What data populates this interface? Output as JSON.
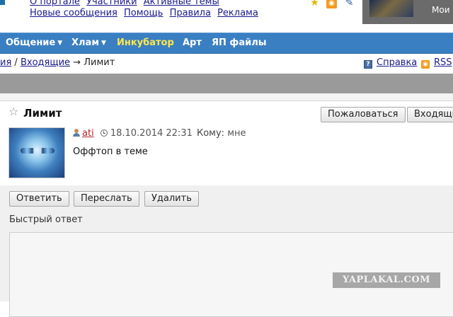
{
  "header": {
    "links_row1": [
      "О портале",
      "Участники",
      "Активные темы"
    ],
    "links_row2": [
      "Новые сообщения",
      "Помощь",
      "Правила",
      "Реклама"
    ],
    "icons": [
      "star-icon",
      "rss-icon",
      "pencil-icon"
    ],
    "user_menu_label": "Мои"
  },
  "nav": {
    "items": [
      {
        "label": "Общение",
        "has_caret": true
      },
      {
        "label": "Хлам",
        "has_caret": true
      },
      {
        "label": "Инкубатор",
        "active": true
      },
      {
        "label": "Арт"
      },
      {
        "label": "ЯП файлы"
      }
    ],
    "bg_color": "#3a7fc2",
    "active_color": "#ffe84a"
  },
  "breadcrumb": {
    "prefix": "ия",
    "sep1": "/",
    "inbox": "Входящие",
    "arrow": "→",
    "current": "Лимит"
  },
  "help_label": "Справка",
  "rss_label": "RSS",
  "message": {
    "title": "Лимит",
    "report_label": "Пожаловаться",
    "inbox_label": "Входящи",
    "sender": "ati",
    "datetime": "18.10.2014 22:31",
    "to_label": "Кому:",
    "to_value": "мне",
    "body": "Оффтоп в теме"
  },
  "actions": {
    "reply": "Ответить",
    "forward": "Переслать",
    "delete": "Удалить"
  },
  "quick_reply": {
    "label": "Быстрый ответ",
    "value": ""
  },
  "watermark": "YAPLAKAL.COM"
}
